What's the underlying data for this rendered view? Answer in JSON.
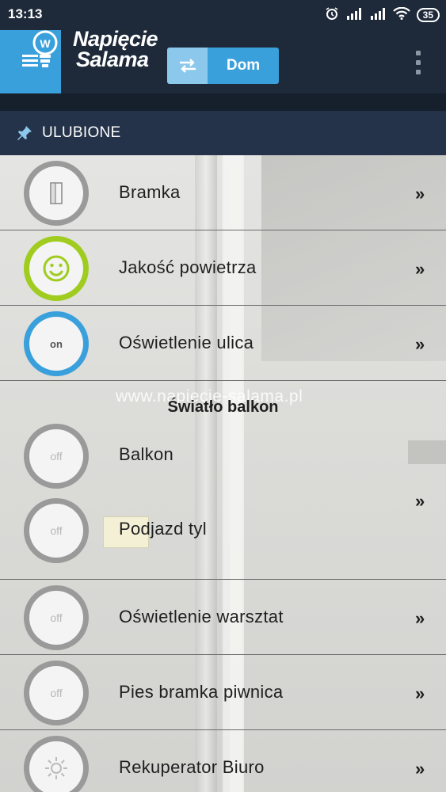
{
  "status_bar": {
    "time": "13:13",
    "battery": "35"
  },
  "header": {
    "logo_line1": "Napięcie",
    "logo_line2": "Salama",
    "home_label": "Dom"
  },
  "favorites_title": "ULUBIONE",
  "rows_top": [
    {
      "name": "Bramka",
      "state": "",
      "icon": "gate-icon",
      "chevron": "»"
    },
    {
      "name": "Jakość powietrza",
      "state": "",
      "icon": "smiley-icon",
      "chevron": "»"
    },
    {
      "name": "Oświetlenie ulica",
      "state": "on",
      "icon": "",
      "chevron": "»"
    }
  ],
  "group": {
    "watermark": "www.napiecie-salama.pl",
    "title": "Światło balkon",
    "chevron": "»",
    "items": [
      {
        "name": "Balkon",
        "state": "off"
      },
      {
        "name": "Podjazd tyl",
        "state": "off"
      }
    ]
  },
  "rows_bottom": [
    {
      "name": "Oświetlenie warsztat",
      "state": "off",
      "chevron": "»"
    },
    {
      "name": "Pies bramka piwnica",
      "state": "off",
      "chevron": "»"
    },
    {
      "name": "Rekuperator Biuro",
      "state": "",
      "icon": "fan-icon",
      "chevron": "»"
    }
  ],
  "colors": {
    "header_bg": "#1e2a3a",
    "accent_blue": "#3aa0db",
    "accent_green": "#9fcc1f",
    "favorites_bar": "#24334a"
  }
}
